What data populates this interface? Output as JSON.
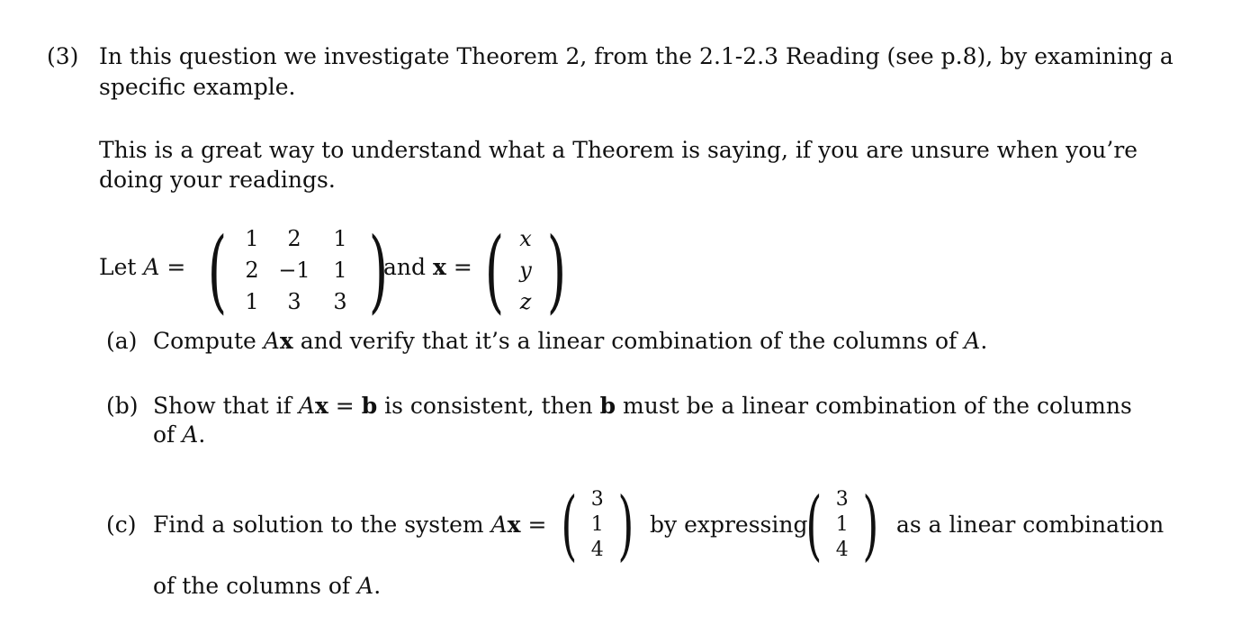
{
  "question": {
    "number": "(3)",
    "intro_line1": "In this question we investigate Theorem 2, from the 2.1-2.3 Reading (see p.8), by examining a",
    "intro_line2": "specific example.",
    "note_line1": "This is a great way to understand what a Theorem is saying, if you are unsure when you’re",
    "note_line2": "doing your readings.",
    "let": "Let",
    "A_symbol": "A",
    "equals": "=",
    "and": "and",
    "x_symbol": "x",
    "period": ".",
    "matrix_A": [
      [
        "1",
        "2",
        "1"
      ],
      [
        "2",
        "−1",
        "1"
      ],
      [
        "1",
        "3",
        "3"
      ]
    ],
    "vector_x": [
      "x",
      "y",
      "z"
    ]
  },
  "parts": {
    "a": {
      "label": "(a)",
      "text1": "Compute",
      "Ax_A": "A",
      "Ax_x": "x",
      "text2": "and verify that it’s a linear combination of the columns of",
      "A": "A",
      "end": "."
    },
    "b": {
      "label": "(b)",
      "text1": "Show that if",
      "A": "A",
      "x": "x",
      "eq": "=",
      "b": "b",
      "text2": "is consistent, then",
      "b2": "b",
      "text3": "must be a linear combination of the columns",
      "line2_pre": "of",
      "line2_A": "A",
      "end": "."
    },
    "c": {
      "label": "(c)",
      "text1": "Find a solution to the system",
      "A": "A",
      "x": "x",
      "eq": "=",
      "vector_b": [
        "3",
        "1",
        "4"
      ],
      "text2": "by expressing",
      "text3": "as a linear combination",
      "line2_pre": "of the columns of",
      "line2_A": "A",
      "end": "."
    }
  }
}
